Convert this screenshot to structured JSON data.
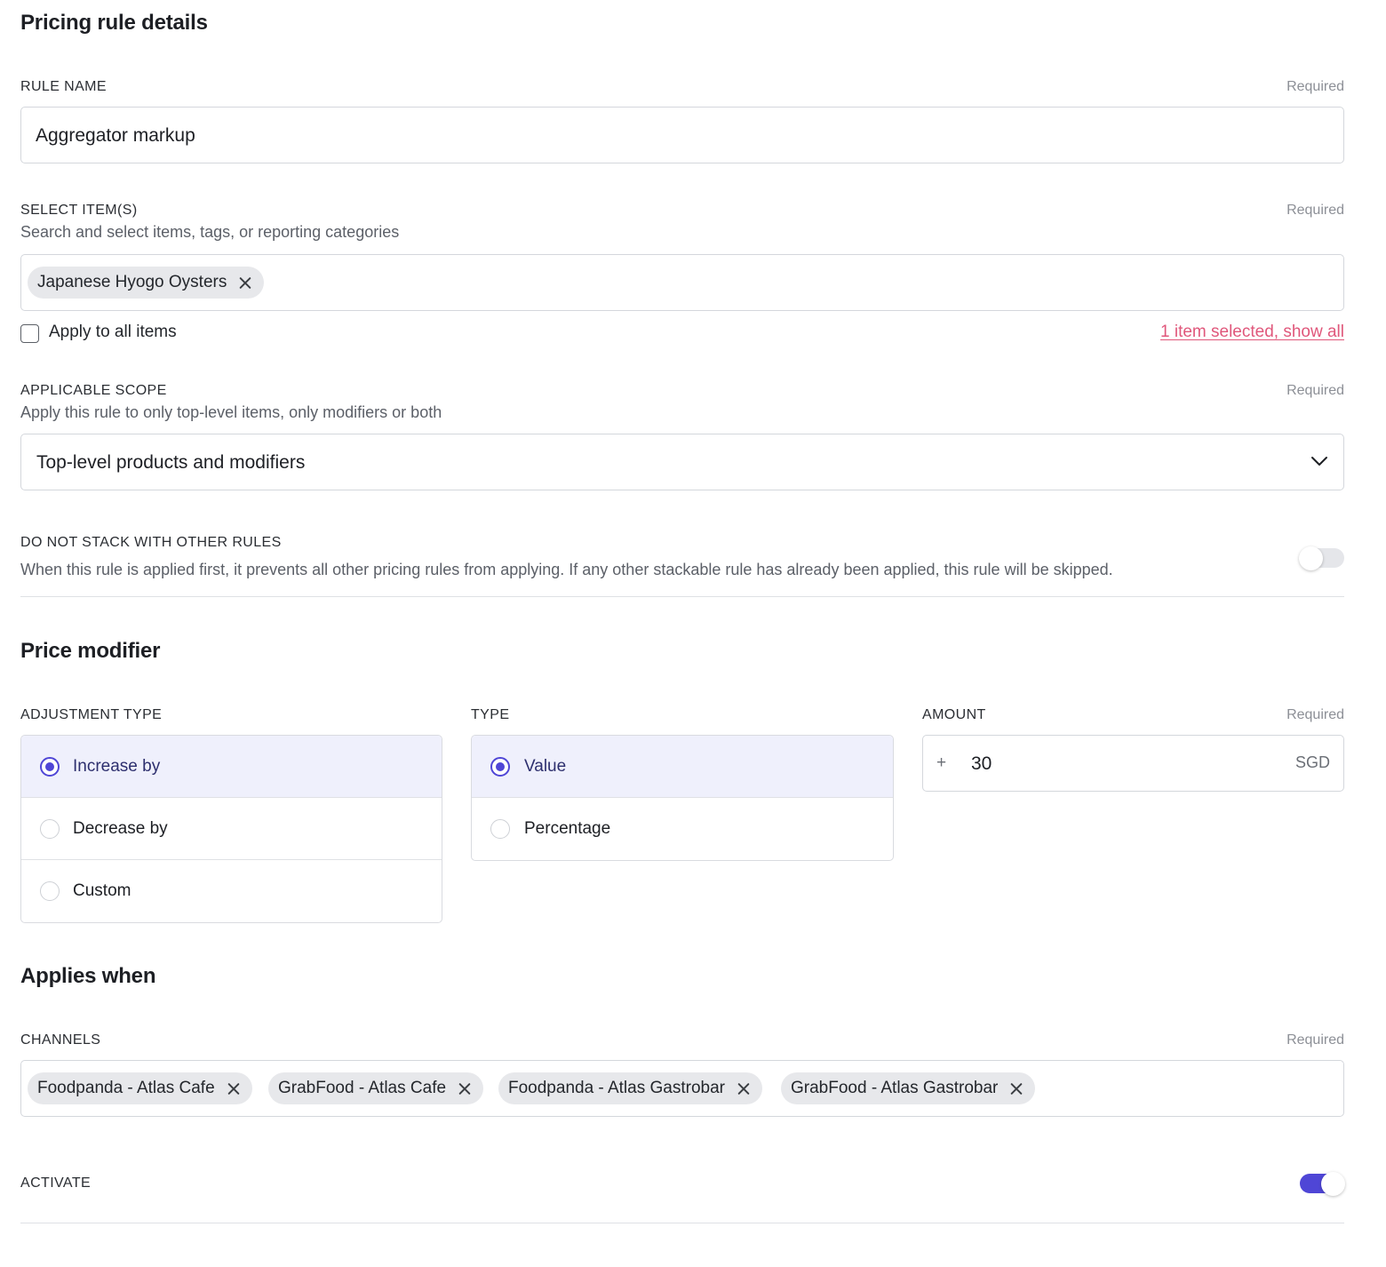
{
  "details": {
    "title": "Pricing rule details",
    "rule_name": {
      "label": "RULE NAME",
      "required": "Required",
      "value": "Aggregator markup"
    },
    "items": {
      "label": "SELECT ITEM(S)",
      "required": "Required",
      "helper": "Search and select items, tags, or reporting categories",
      "chips": [
        "Japanese Hyogo Oysters"
      ],
      "apply_all_label": "Apply to all items",
      "apply_all_checked": false,
      "selection_link": "1 item selected, show all"
    },
    "scope": {
      "label": "APPLICABLE SCOPE",
      "required": "Required",
      "helper": "Apply this rule to only top-level items, only modifiers or both",
      "selected": "Top-level products and modifiers"
    },
    "stack": {
      "label": "DO NOT STACK WITH OTHER RULES",
      "helper": "When this rule is applied first, it prevents all other pricing rules from applying. If any other stackable rule has already been applied, this rule will be skipped.",
      "enabled": false
    }
  },
  "modifier": {
    "title": "Price modifier",
    "adjustment": {
      "label": "ADJUSTMENT TYPE",
      "options": [
        "Increase by",
        "Decrease by",
        "Custom"
      ],
      "selected": "Increase by"
    },
    "type": {
      "label": "TYPE",
      "options": [
        "Value",
        "Percentage"
      ],
      "selected": "Value"
    },
    "amount": {
      "label": "AMOUNT",
      "required": "Required",
      "prefix": "+",
      "value": "30",
      "currency": "SGD"
    }
  },
  "applies": {
    "title": "Applies when",
    "channels": {
      "label": "CHANNELS",
      "required": "Required",
      "chips": [
        "Foodpanda - Atlas Cafe",
        "GrabFood - Atlas Cafe",
        "Foodpanda - Atlas Gastrobar",
        "GrabFood - Atlas Gastrobar"
      ]
    },
    "activate": {
      "label": "ACTIVATE",
      "enabled": true
    }
  },
  "colors": {
    "accent": "#4f46d6",
    "link": "#e0577b",
    "selected_bg": "#eff0fc"
  }
}
